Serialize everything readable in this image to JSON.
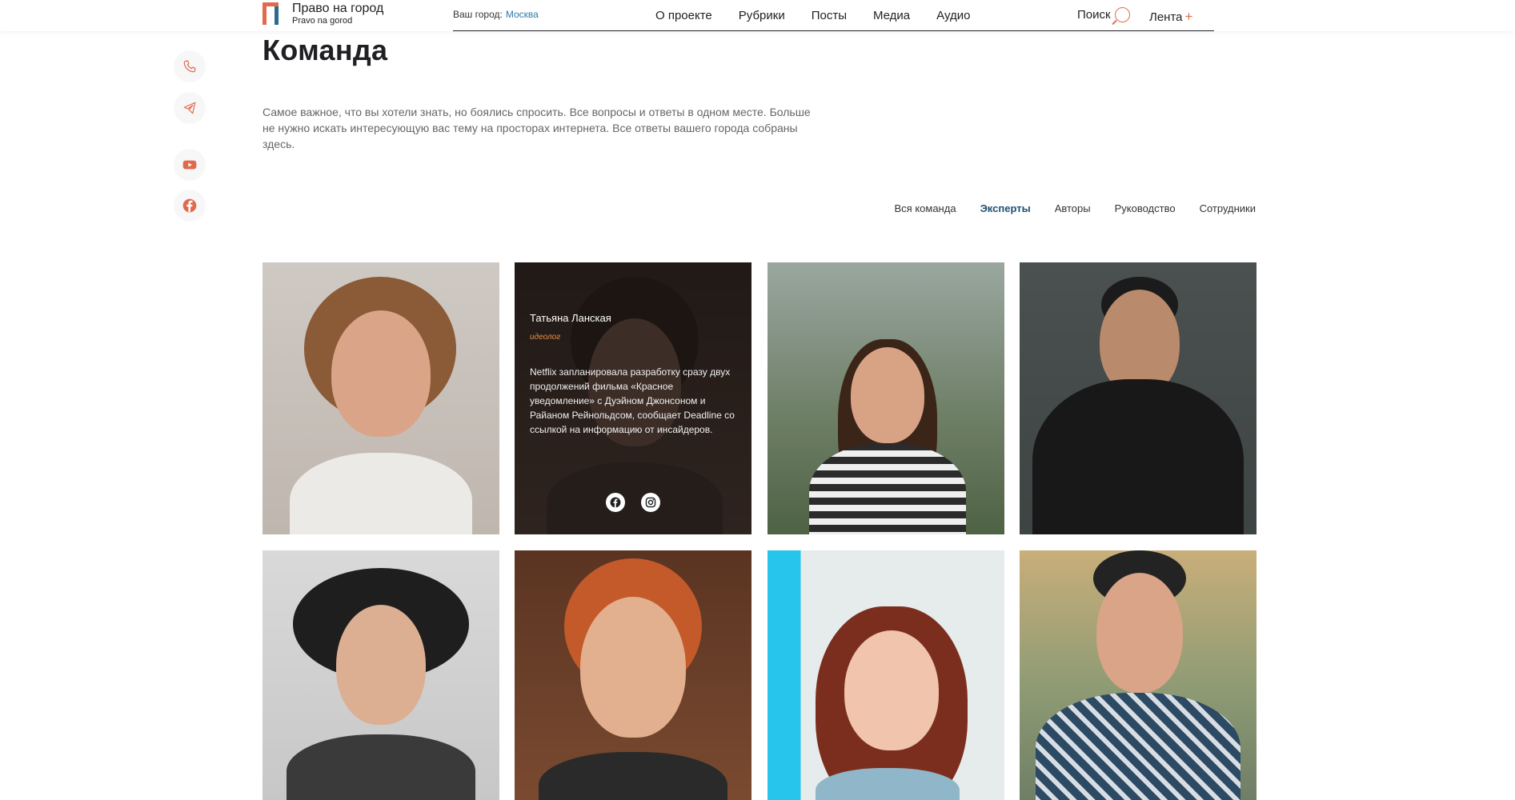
{
  "header": {
    "logo_title": "Право на город",
    "logo_subtitle": "Pravo na gorod",
    "city_label": "Ваш город:",
    "city_name": "Москва",
    "nav": [
      "О проекте",
      "Рубрики",
      "Посты",
      "Медиа",
      "Аудио"
    ],
    "search_label": "Поиск",
    "feed_label": "Лента",
    "feed_plus": "+"
  },
  "social": [
    {
      "icon": "phone-icon"
    },
    {
      "icon": "telegram-icon"
    },
    {
      "icon": "youtube-icon"
    },
    {
      "icon": "facebook-icon"
    }
  ],
  "page": {
    "title": "Команда",
    "intro": "Самое важное, что вы хотели знать, но боялись спросить. Все вопросы и ответы в одном месте. Больше не нужно искать интересующую вас тему на просторах интернета. Все ответы вашего города собраны здесь."
  },
  "filters": {
    "active": "Эксперты",
    "items": [
      "Вся команда",
      "Эксперты",
      "Авторы",
      "Руководство",
      "Сотрудники"
    ]
  },
  "team": {
    "highlighted": {
      "name": "Татьяна Ланская",
      "role": "идеолог",
      "bio": "Netflix запланировала разработку сразу двух продолжений фильма «Красное уведомление» с Дуэйном Джонсоном и Райаном Рейнольдсом, сообщает Deadline со ссылкой на информацию от инсайдеров.",
      "links": [
        "facebook-icon",
        "instagram-icon"
      ]
    }
  },
  "colors": {
    "accent": "#e06a4b",
    "link": "#2d7aa8",
    "active_filter": "#1e4f72",
    "text": "#1f1f24"
  }
}
